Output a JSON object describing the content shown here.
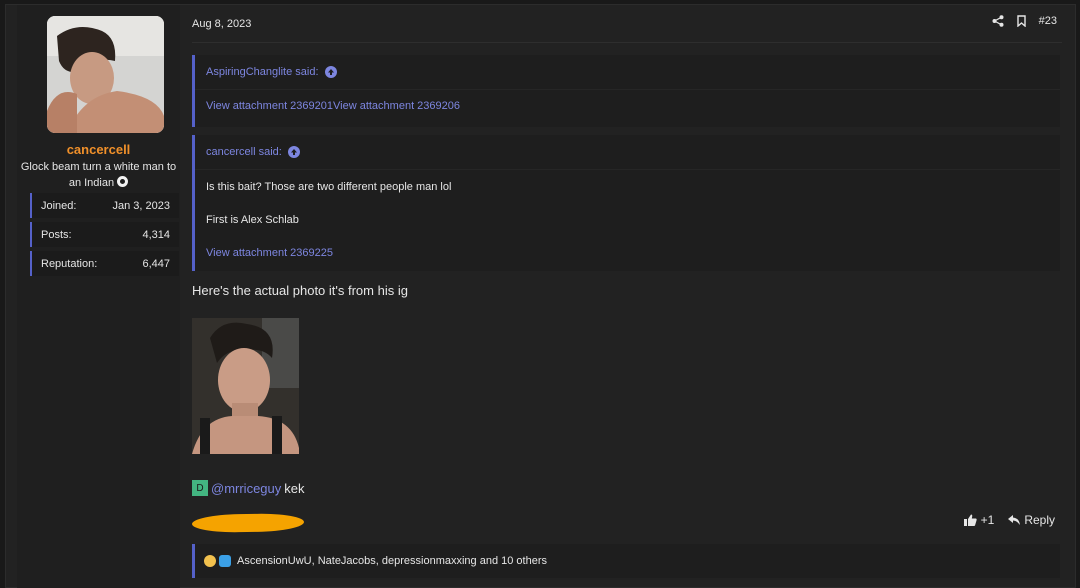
{
  "user": {
    "name": "cancercell",
    "title": "Glock beam turn a white man to an Indian",
    "title_emoji": "record-icon",
    "stats": [
      {
        "label": "Joined:",
        "value": "Jan 3, 2023"
      },
      {
        "label": "Posts:",
        "value": "4,314"
      },
      {
        "label": "Reputation:",
        "value": "6,447"
      }
    ]
  },
  "post": {
    "date": "Aug 8, 2023",
    "number": "#23",
    "quotes": [
      {
        "author": "AspiringChanglite said:",
        "body_lines": [],
        "links": "View attachment 2369201View attachment 2369206"
      },
      {
        "author": "cancercell said:",
        "body_lines": [
          "Is this bait? Those are two different people man lol",
          "First is Alex Schlab"
        ],
        "links": "View attachment 2369225"
      }
    ],
    "message": "Here's the actual photo it's from his ig",
    "mention_badge": "D",
    "mention": "@mrriceguy",
    "mention_suffix": "kek",
    "like_count": "+1",
    "reply_label": "Reply",
    "reactions_text": "AscensionUwU, NateJacobs, depressionmaxxing and 10 others"
  },
  "colors": {
    "accent": "#5561c9",
    "link": "#7d86e0",
    "username": "#f0902a",
    "redaction": "#f5a300",
    "badge": "#43b581"
  }
}
